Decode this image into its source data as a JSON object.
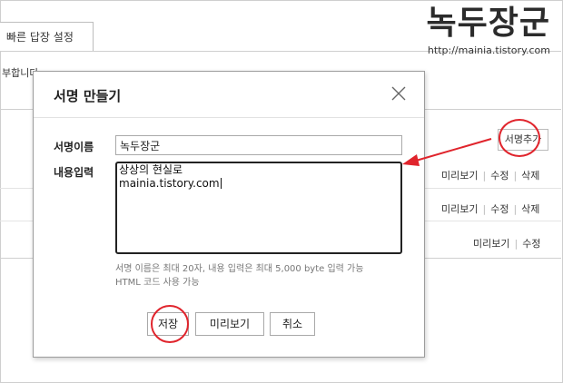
{
  "background": {
    "tab_label": "빠른 답장 설정",
    "side_text": "부합니다",
    "add_signature_button": "서명추가",
    "rows": [
      {
        "actions": [
          "미리보기",
          "수정",
          "삭제"
        ]
      },
      {
        "actions": [
          "미리보기",
          "수정",
          "삭제"
        ]
      },
      {
        "actions": [
          "미리보기",
          "수정"
        ]
      }
    ]
  },
  "watermark": {
    "title": "녹두장군",
    "url": "http://mainia.tistory.com"
  },
  "dialog": {
    "title": "서명 만들기",
    "name_label": "서명이름",
    "name_value": "녹두장군",
    "content_label": "내용입력",
    "content_lines": [
      "상상의 현실로",
      "mainia.tistory.com"
    ],
    "help_lines": [
      "서명 이름은 최대 20자, 내용 입력은 최대 5,000 byte 입력 가능",
      "HTML 코드 사용 가능"
    ],
    "buttons": {
      "save": "저장",
      "preview": "미리보기",
      "cancel": "취소"
    }
  },
  "colors": {
    "annotation": "#e0242c"
  },
  "icons": {
    "close": "close-icon"
  }
}
